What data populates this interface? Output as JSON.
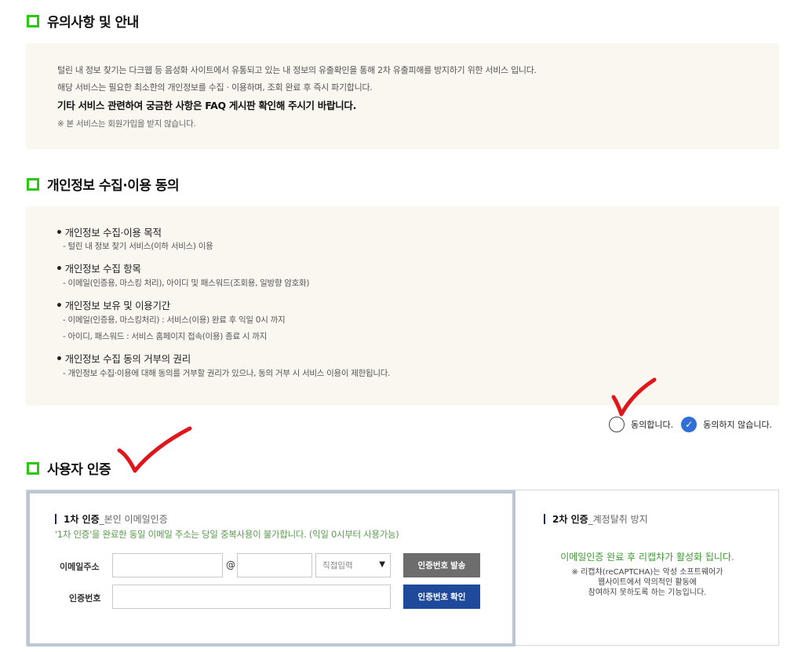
{
  "notice": {
    "title": "유의사항 및 안내",
    "lines": [
      "털린 내 정보 찾기는 다크웹 등 음성화 사이트에서 유통되고 있는 내 정보의 유출확인을 통해 2차 유출피해를 방지하기 위한 서비스 입니다.",
      "해당 서비스는 필요한 최소한의 개인정보를 수집 · 이용하며, 조회 완료 후 즉시 파기합니다.",
      "기타 서비스 관련하여 궁금한 사항은 FAQ 게시판 확인해 주시기 바랍니다.",
      "※ 본 서비스는 회원가입을 받지 않습니다."
    ]
  },
  "consent": {
    "title": "개인정보 수집·이용 동의",
    "items": [
      {
        "heading": "개인정보 수집·이용 목적",
        "details": [
          "- 털린 내 정보 찾기 서비스(이하 서비스) 이용"
        ]
      },
      {
        "heading": "개인정보 수집 항목",
        "details": [
          "- 이메일(인증용, 마스킹 처리), 아이디 및 패스워드(조회용, 일방향 암호화)"
        ]
      },
      {
        "heading": "개인정보 보유 및 이용기간",
        "details": [
          "- 이메일(인증용, 마스킹처리) : 서비스(이용) 완료 후 익일 0시 까지",
          "- 아이디, 패스워드 : 서비스 홈페이지 접속(이용) 종료 시 까지"
        ]
      },
      {
        "heading": "개인정보 수집 동의 거부의 권리",
        "details": [
          "- 개인정보 수집·이용에 대해 동의를 거부할 권리가 있으나, 동의 거부 시 서비스 이용이 제한됩니다."
        ]
      }
    ],
    "agree_label": "동의합니다.",
    "disagree_label": "동의하지 않습니다.",
    "selected": "disagree"
  },
  "auth": {
    "title": "사용자 인증",
    "first": {
      "step": "1차 인증",
      "desc": "_본인 이메일인증",
      "note": "'1차 인증'을 완료한 동일 이메일 주소는 당일 중복사용이 불가합니다. (익일 0시부터 사용가능)",
      "email_label": "이메일주소",
      "at": "@",
      "domain_select": "직접입력",
      "send_button": "인증번호 발송",
      "code_label": "인증번호",
      "verify_button": "인증번호 확인"
    },
    "second": {
      "step": "2차 인증",
      "desc": "_계정탈취 방지",
      "highlight": "이메일인증 완료 후 리캡챠가 활성화 됩니다.",
      "info_lines": [
        "※ 리캡챠(reCAPTCHA)는 악성 소프트웨어가",
        "웹사이트에서 악의적인 활동에",
        "참여하지 못하도록 하는 기능입니다."
      ]
    }
  },
  "colors": {
    "section_box": "#2bc80f",
    "panel_bg": "#f9f7f0",
    "check_mark": "#e0161c",
    "radio_selected": "#2f6fd6",
    "note_green": "#5a9a4e",
    "btn_gray": "#6d6d6d",
    "btn_blue": "#1f4a9c"
  }
}
